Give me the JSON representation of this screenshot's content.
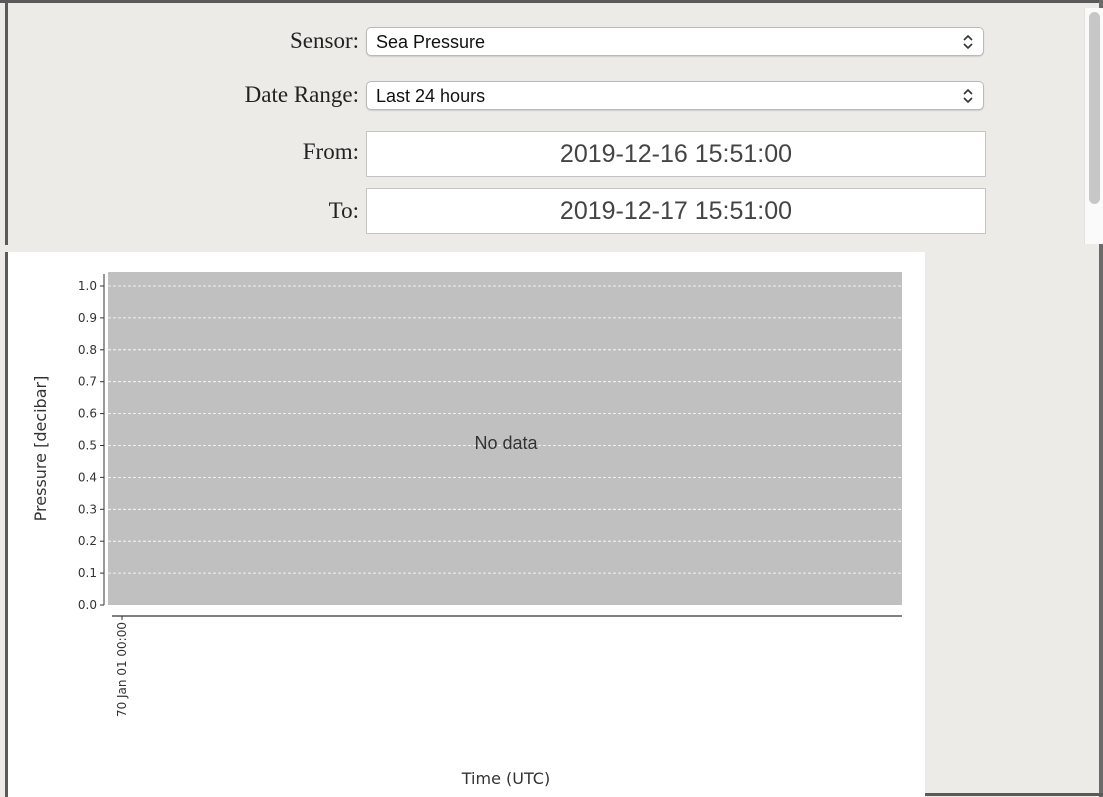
{
  "form": {
    "sensor": {
      "label": "Sensor:",
      "value": "Sea Pressure"
    },
    "date_range": {
      "label": "Date Range:",
      "value": "Last 24 hours"
    },
    "from": {
      "label": "From:",
      "value": "2019-12-16 15:51:00"
    },
    "to": {
      "label": "To:",
      "value": "2019-12-17 15:51:00"
    }
  },
  "icons": {
    "select_arrows": "chevron-up-down-icon"
  },
  "chart_data": {
    "type": "line",
    "title": "",
    "xlabel": "Time (UTC)",
    "ylabel": "Pressure [decibar]",
    "x": [],
    "series": [],
    "ylim": [
      0.0,
      1.0
    ],
    "y_ticks": [
      "0.0",
      "0.1",
      "0.2",
      "0.3",
      "0.4",
      "0.5",
      "0.6",
      "0.7",
      "0.8",
      "0.9",
      "1.0"
    ],
    "x_ticks": [
      "70 Jan 01 00:00"
    ],
    "message": "No data",
    "grid": true,
    "plot_background": "#c0c0c0",
    "grid_color": "#ffffff"
  }
}
